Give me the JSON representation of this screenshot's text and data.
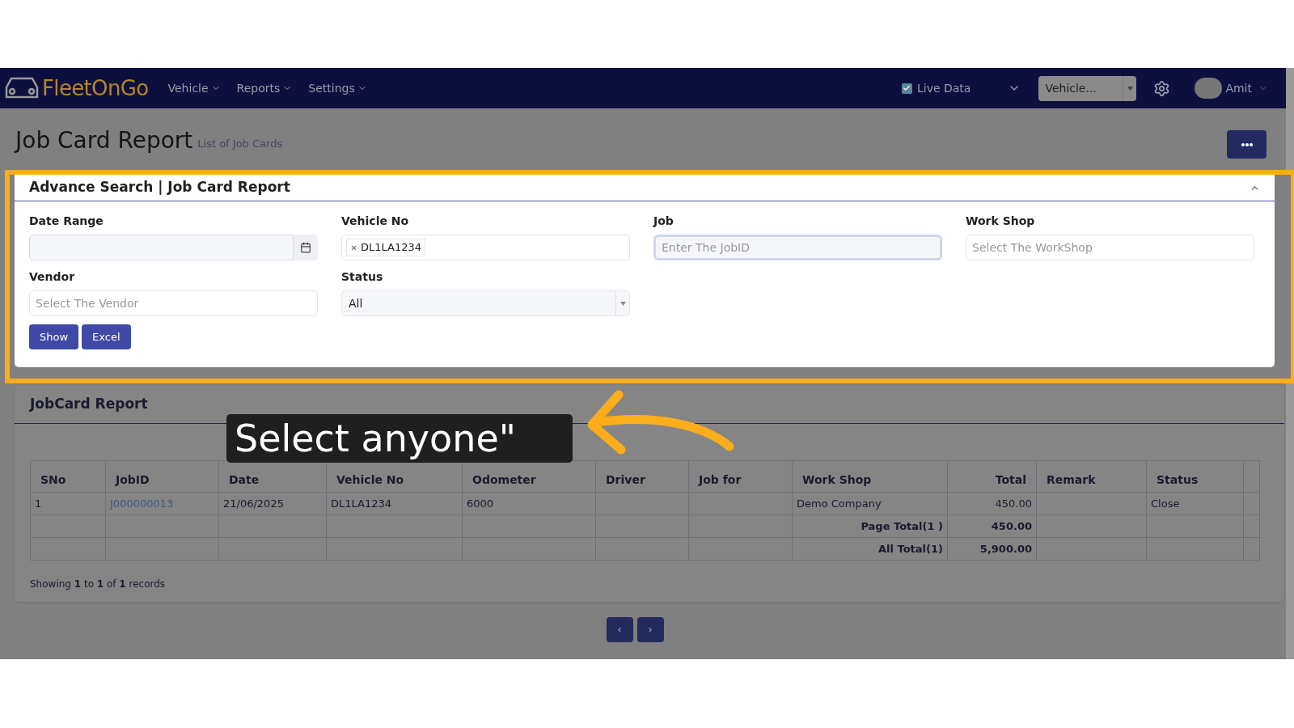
{
  "nav": {
    "logo": "FleetOnGo",
    "menus": [
      "Vehicle",
      "Reports",
      "Settings"
    ],
    "live_data": {
      "label": "Live Data",
      "checked": true
    },
    "vehicle_select": {
      "placeholder": "Vehicle..."
    },
    "user": "Amit"
  },
  "page": {
    "title": "Job Card Report",
    "subtitle": "List of Job Cards"
  },
  "search": {
    "title": "Advance Search | Job Card Report",
    "expanded": true,
    "fields": [
      {
        "kind": "date",
        "label": "Date Range"
      },
      {
        "kind": "tags",
        "label": "Vehicle No",
        "tags": [
          "DL1LA1234"
        ]
      },
      {
        "kind": "text",
        "label": "Job",
        "placeholder": "Enter The JobID",
        "focused": true
      },
      {
        "kind": "text",
        "label": "Work Shop",
        "placeholder": "Select The WorkShop",
        "focused": false
      },
      {
        "kind": "text",
        "label": "Vendor",
        "placeholder": "Select The Vendor",
        "focused": false
      },
      {
        "kind": "select",
        "label": "Status",
        "value": "All"
      }
    ],
    "buttons": [
      "Show",
      "Excel"
    ]
  },
  "report": {
    "title": "JobCard Report",
    "columns": [
      "SNo",
      "JobID",
      "Date",
      "Vehicle No",
      "Odometer",
      "Driver",
      "Job for",
      "Work Shop",
      "Total",
      "Remark",
      "Status"
    ],
    "rows": [
      {
        "kind": "data",
        "cells": [
          "1",
          "J000000013",
          "21/06/2025",
          "DL1LA1234",
          "6000",
          null,
          null,
          "Demo Company",
          "450.00",
          null,
          "Close"
        ]
      },
      {
        "kind": "total",
        "cells": [
          null,
          null,
          null,
          null,
          null,
          null,
          null,
          "Page Total(1 )",
          "450.00",
          null,
          null
        ]
      },
      {
        "kind": "total",
        "cells": [
          null,
          null,
          null,
          null,
          null,
          null,
          null,
          "All Total(1)",
          "5,900.00",
          null,
          null
        ]
      }
    ],
    "footer": "Showing **1** to **1** of **1** records",
    "pager": [
      "‹",
      "›"
    ]
  },
  "callout": {
    "text": "Select anyone\""
  }
}
